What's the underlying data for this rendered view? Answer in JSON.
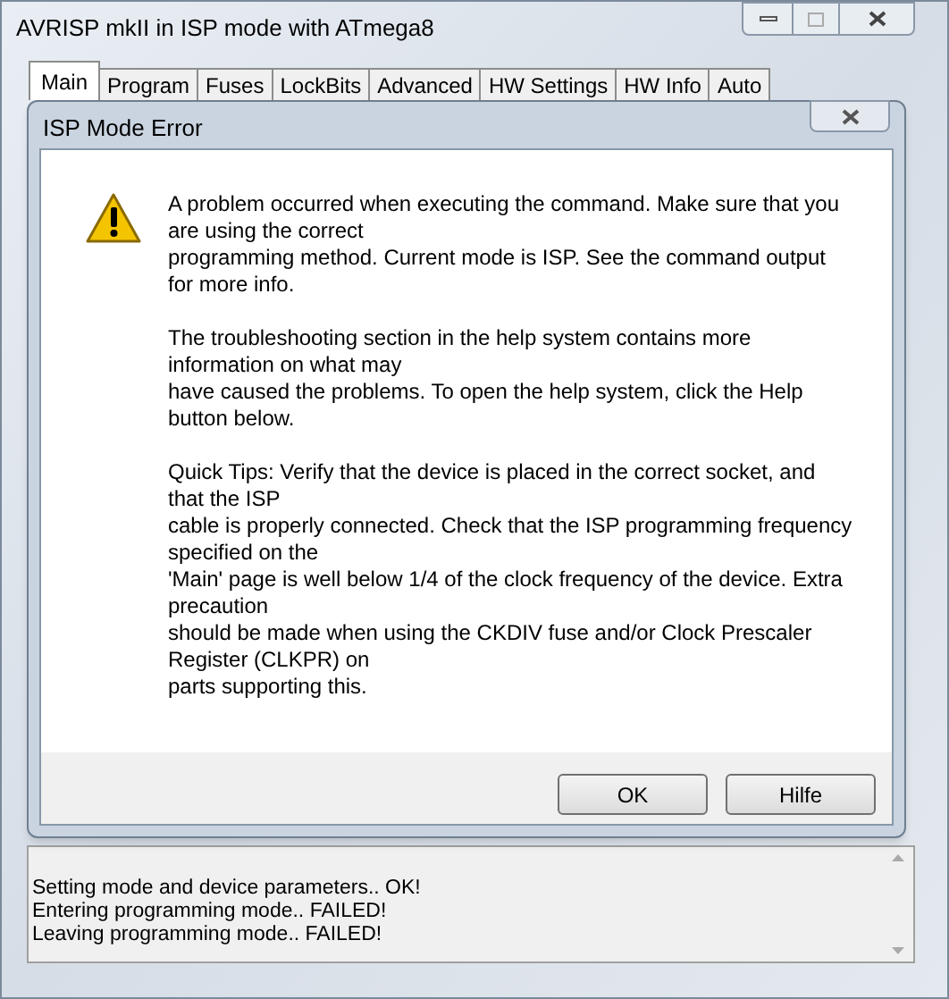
{
  "window": {
    "title": "AVRISP mkII in ISP mode with ATmega8"
  },
  "tabs": [
    {
      "label": "Main",
      "selected": true
    },
    {
      "label": "Program",
      "selected": false
    },
    {
      "label": "Fuses",
      "selected": false
    },
    {
      "label": "LockBits",
      "selected": false
    },
    {
      "label": "Advanced",
      "selected": false
    },
    {
      "label": "HW Settings",
      "selected": false
    },
    {
      "label": "HW Info",
      "selected": false
    },
    {
      "label": "Auto",
      "selected": false
    }
  ],
  "dialog": {
    "title": "ISP Mode Error",
    "paragraphs": [
      [
        "A problem occurred when executing the command. Make sure that you",
        "are using the correct",
        "programming method. Current mode is ISP. See the command output",
        "for more info."
      ],
      [
        "The troubleshooting section in the help system contains more",
        "information on what may",
        "have caused the problems. To open the help system, click the Help",
        "button below."
      ],
      [
        "Quick Tips: Verify that the device is placed in the correct socket, and",
        "that the ISP",
        "cable is properly connected. Check that the ISP programming frequency",
        "specified on the",
        "'Main' page is well below 1/4 of the clock frequency of the device. Extra",
        "precaution",
        "should be made when using the CKDIV fuse and/or Clock Prescaler",
        "Register (CLKPR) on",
        "parts supporting this."
      ]
    ],
    "buttons": [
      "OK",
      "Hilfe"
    ]
  },
  "log": [
    "Setting mode and device parameters.. OK!",
    "Entering programming mode.. FAILED!",
    "Leaving programming mode.. FAILED!"
  ]
}
